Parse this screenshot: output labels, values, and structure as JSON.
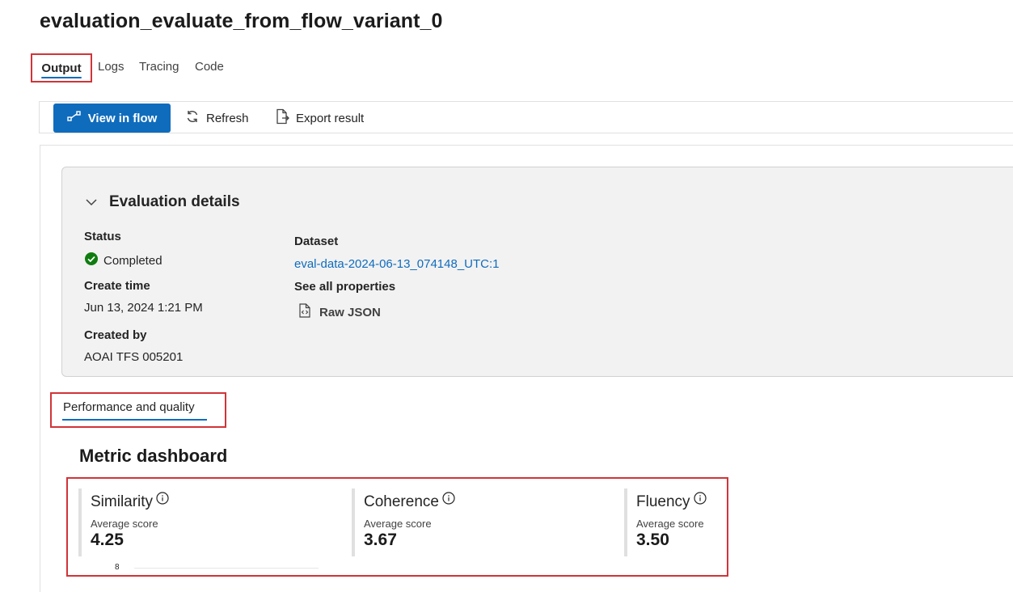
{
  "page": {
    "title": "evaluation_evaluate_from_flow_variant_0"
  },
  "tabs": [
    {
      "label": "Output"
    },
    {
      "label": "Logs"
    },
    {
      "label": "Tracing"
    },
    {
      "label": "Code"
    }
  ],
  "toolbar": {
    "view_in_flow": "View in flow",
    "refresh": "Refresh",
    "export_result": "Export result"
  },
  "details": {
    "header": "Evaluation details",
    "status_label": "Status",
    "status_value": "Completed",
    "create_time_label": "Create time",
    "create_time_value": "Jun 13, 2024 1:21 PM",
    "created_by_label": "Created by",
    "created_by_value": "AOAI TFS 005201",
    "dataset_label": "Dataset",
    "dataset_value": "eval-data-2024-06-13_074148_UTC:1",
    "see_all_label": "See all properties",
    "raw_json": "Raw JSON"
  },
  "performance": {
    "tab_label": "Performance and quality",
    "dashboard_title": "Metric dashboard",
    "metrics": [
      {
        "name": "Similarity",
        "sub": "Average score",
        "value": "4.25"
      },
      {
        "name": "Coherence",
        "sub": "Average score",
        "value": "3.67"
      },
      {
        "name": "Fluency",
        "sub": "Average score",
        "value": "3.50"
      }
    ],
    "axis_tick": "8"
  },
  "colors": {
    "accent": "#0f6cbd",
    "highlight": "#d13438",
    "success": "#107c10"
  }
}
